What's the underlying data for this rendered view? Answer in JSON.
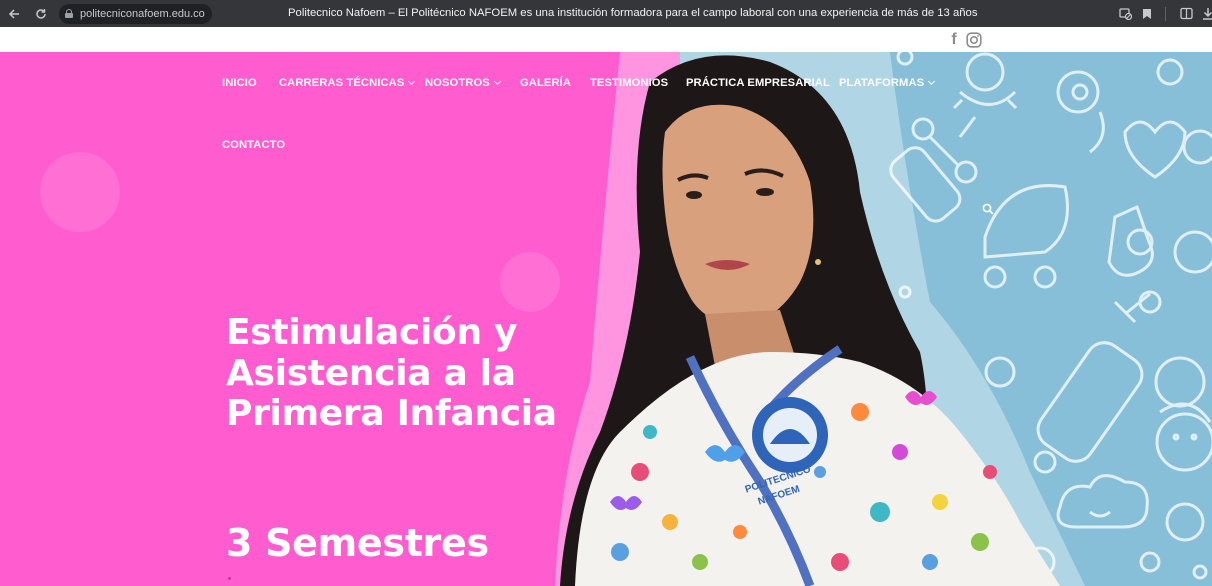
{
  "browser": {
    "url": "politecniconafoem.edu.co",
    "tab_title": "Politecnico Nafoem – El Politécnico NAFOEM es una institución formadora para el campo laboral con una experiencia de más de 13 años",
    "icons": [
      "back-arrow-icon",
      "reload-icon",
      "lock-icon",
      "blocked-popup-icon",
      "bookmark-icon",
      "reading-list-icon",
      "download-icon"
    ]
  },
  "social": {
    "facebook_glyph": "f",
    "icons": [
      "facebook-icon",
      "instagram-icon"
    ]
  },
  "nav": {
    "items": [
      {
        "label": "INICIO",
        "has_dropdown": false
      },
      {
        "label": "CARRERAS TÉCNICAS",
        "has_dropdown": true
      },
      {
        "label": "NOSOTROS",
        "has_dropdown": true
      },
      {
        "label": "GALERÍA",
        "has_dropdown": false
      },
      {
        "label": "TESTIMONIOS",
        "has_dropdown": false
      },
      {
        "label": "PRÁCTICA EMPRESARIAL",
        "has_dropdown": false
      },
      {
        "label": "PLATAFORMAS",
        "has_dropdown": true
      },
      {
        "label": "CONTACTO",
        "has_dropdown": false
      }
    ]
  },
  "hero": {
    "title_lines": [
      "Estimulación y",
      "Asistencia a la",
      "Primera Infancia"
    ],
    "duration": "3 Semestres",
    "badge_line1": "POLITECNICO",
    "badge_line2": "NAFOEM"
  },
  "colors": {
    "pink": "#ff5ccf",
    "blue": "#86bfd7",
    "chrome_bg": "#35363a",
    "text_white": "#ffffff"
  }
}
